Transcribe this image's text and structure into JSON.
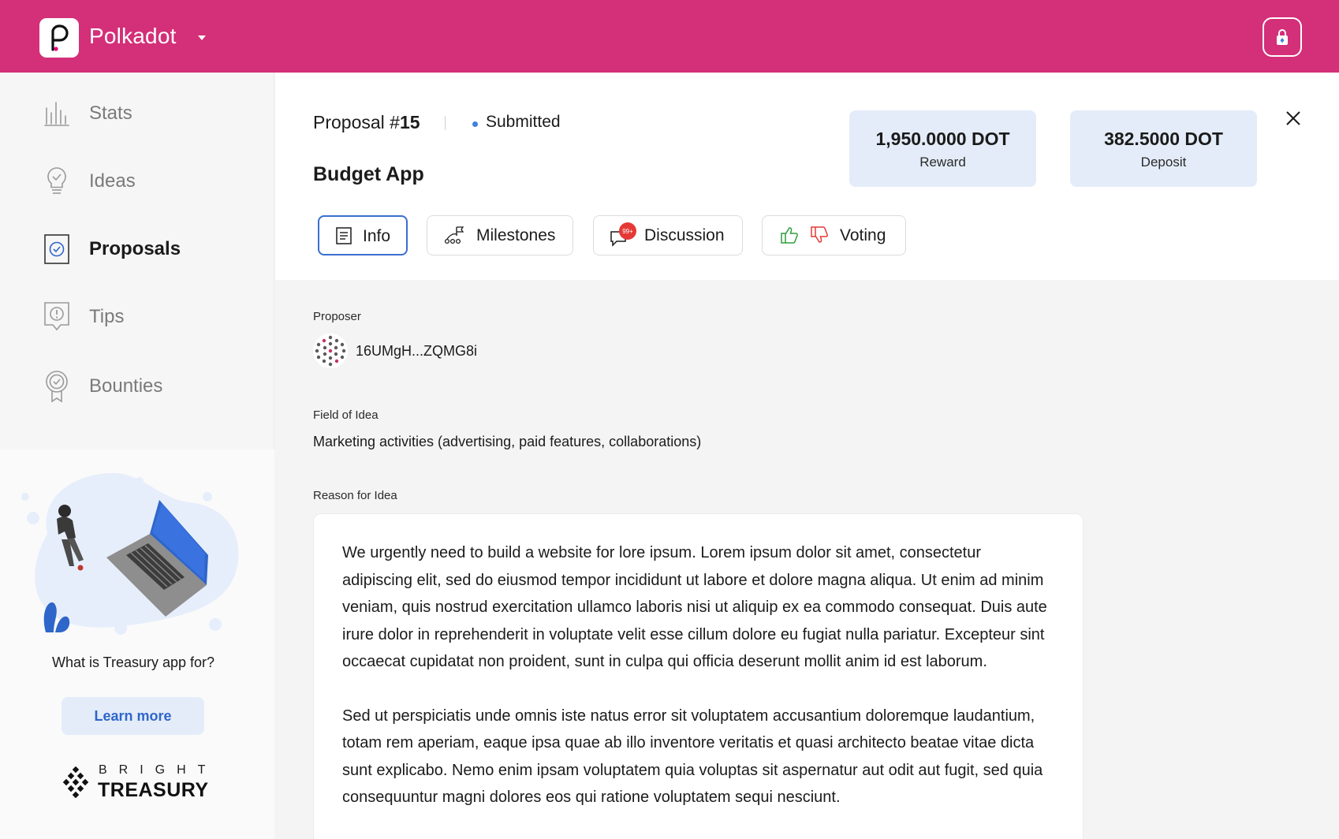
{
  "app": {
    "network_name": "Polkadot"
  },
  "sidebar": {
    "items": [
      {
        "label": "Stats"
      },
      {
        "label": "Ideas"
      },
      {
        "label": "Proposals"
      },
      {
        "label": "Tips"
      },
      {
        "label": "Bounties"
      }
    ],
    "active": "Proposals",
    "promo_text": "What is Treasury app for?",
    "learn_more_label": "Learn more",
    "brand_top": "BRIGHT",
    "brand_bottom": "TREASURY"
  },
  "proposal": {
    "number_prefix": "Proposal #",
    "number": "15",
    "status": "Submitted",
    "title": "Budget App",
    "reward_value": "1,950.0000 DOT",
    "reward_label": "Reward",
    "deposit_value": "382.5000 DOT",
    "deposit_label": "Deposit"
  },
  "tabs": [
    {
      "label": "Info",
      "active": true
    },
    {
      "label": "Milestones"
    },
    {
      "label": "Discussion",
      "badge": "99+"
    },
    {
      "label": "Voting"
    }
  ],
  "details": {
    "proposer_label": "Proposer",
    "proposer_address": "16UMgH...ZQMG8i",
    "field_label": "Field of Idea",
    "field_value": "Marketing activities (advertising, paid features, collaborations)",
    "reason_label": "Reason for Idea",
    "reason_paragraphs": [
      "We urgently need to build a website for lore ipsum. Lorem ipsum dolor sit amet, consectetur adipiscing elit, sed do eiusmod tempor incididunt ut labore et dolore magna aliqua. Ut enim ad minim veniam, quis nostrud exercitation ullamco laboris nisi ut aliquip ex ea commodo consequat. Duis aute irure dolor in reprehenderit in voluptate velit esse cillum dolore eu fugiat nulla pariatur. Excepteur sint occaecat cupidatat non proident, sunt in culpa qui officia deserunt mollit anim id est laborum.",
      "Sed ut perspiciatis unde omnis iste natus error sit voluptatem accusantium doloremque laudantium, totam rem aperiam, eaque ipsa quae ab illo inventore veritatis et quasi architecto beatae vitae dicta sunt explicabo. Nemo enim ipsam voluptatem quia voluptas sit aspernatur aut odit aut fugit, sed quia consequuntur magni dolores eos qui ratione voluptatem sequi nesciunt."
    ]
  },
  "icons": {
    "logo": "polkadot-logo-icon",
    "caret": "chevron-down-icon",
    "account": "lock-icon",
    "close": "close-icon"
  },
  "colors": {
    "brand": "#d42f79",
    "accent": "#3a6fd0",
    "card_bg": "#e4ecf9",
    "badge": "#e53935"
  }
}
